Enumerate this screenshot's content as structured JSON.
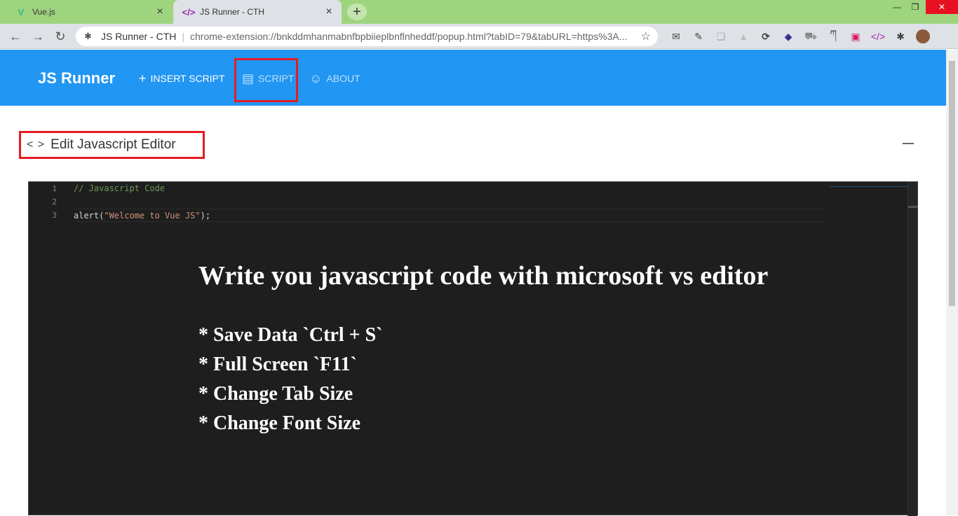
{
  "browser": {
    "tabs": [
      {
        "title": "Vue.js",
        "favicon": "vue-icon"
      },
      {
        "title": "JS Runner - CTH",
        "favicon": "code-icon"
      }
    ],
    "new_tab": "+",
    "window_controls": {
      "minimize": "—",
      "restore": "❐",
      "close": "✕"
    },
    "nav": {
      "back": "←",
      "forward": "→",
      "reload": "↻"
    },
    "address": {
      "site": "JS Runner - CTH",
      "separator": "|",
      "url": "chrome-extension://bnkddmhanmabnfbpbiieplbnflnheddf/popup.html?tabID=79&tabURL=https%3A..."
    },
    "extensions": [
      "mail-icon",
      "pen-icon",
      "copy-icon",
      "triangle-icon",
      "refresh-icon",
      "diamond-icon",
      "cart-icon",
      "translate-icon",
      "layers-icon",
      "code-icon",
      "puzzle-icon",
      "avatar"
    ]
  },
  "app": {
    "brand": "JS Runner",
    "nav": [
      {
        "label": "INSERT SCRIPT",
        "icon": "plus-icon"
      },
      {
        "label": "SCRIPT",
        "icon": "document-icon"
      },
      {
        "label": "ABOUT",
        "icon": "smile-icon"
      }
    ],
    "accent_color": "#2196f3"
  },
  "editor_section": {
    "title": "Edit Javascript Editor",
    "lines": [
      {
        "number": "1",
        "text": "// Javascript Code"
      },
      {
        "number": "2",
        "text": ""
      },
      {
        "number": "3",
        "prefix": "alert(",
        "string": "\"Welcome to Vue JS\"",
        "suffix": ");"
      }
    ],
    "help_heading": "Write you javascript code with microsoft vs editor",
    "help_items": [
      "* Save Data `Ctrl + S`",
      "* Full Screen `F11`",
      "* Change Tab Size",
      "* Change Font Size"
    ]
  },
  "highlight_color": "#e51c23"
}
